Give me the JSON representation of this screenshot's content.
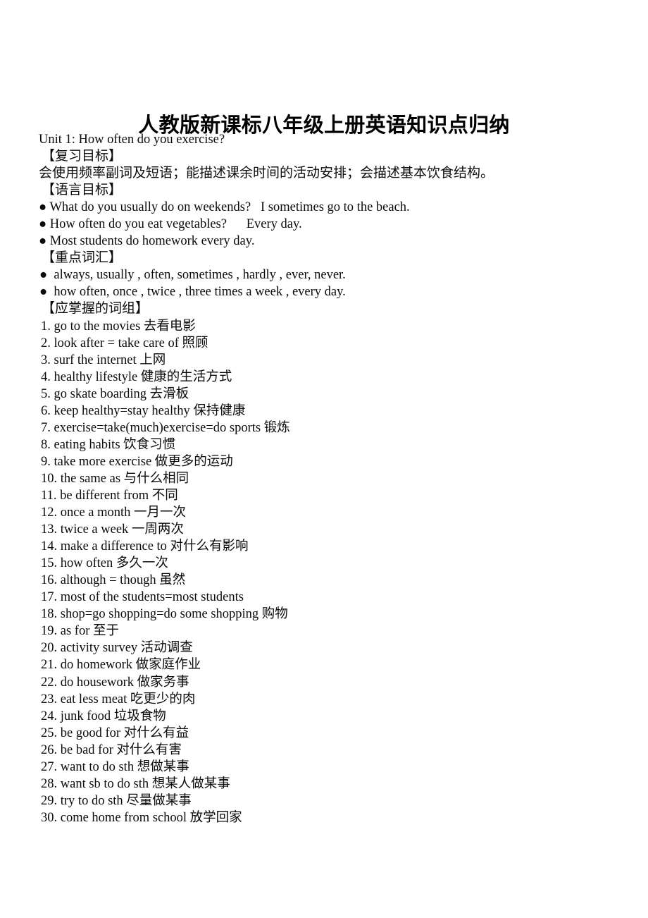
{
  "document": {
    "title": "人教版新课标八年级上册英语知识点归纳",
    "unit_heading": "Unit 1: How often do you exercise?",
    "sections": {
      "review_goal_heading": "【复习目标】",
      "review_goal_text": "会使用频率副词及短语；能描述课余时间的活动安排；会描述基本饮食结构。",
      "language_goal_heading": "【语言目标】",
      "language_goal_bullets": [
        "● What do you usually do on weekends?   I sometimes go to the beach.",
        "● How often do you eat vegetables?      Every day.",
        "● Most students do homework every day."
      ],
      "key_vocab_heading": "【重点词汇】",
      "key_vocab_bullets": [
        "●  always, usually , often, sometimes , hardly , ever, never.",
        "●  how often, once , twice , three times a week , every day."
      ],
      "phrases_heading": "【应掌握的词组】",
      "phrases": [
        "1. go to the movies 去看电影",
        "2. look after = take care of 照顾",
        "3. surf the internet 上网",
        "4. healthy lifestyle 健康的生活方式",
        "5. go skate boarding 去滑板",
        "6. keep healthy=stay healthy 保持健康",
        "7. exercise=take(much)exercise=do sports 锻炼",
        "8. eating habits 饮食习惯",
        "9. take more exercise 做更多的运动",
        "10. the same as 与什么相同",
        "11. be different from 不同",
        "12. once a month 一月一次",
        "13. twice a week 一周两次",
        "14. make a difference to 对什么有影响",
        "15. how often 多久一次",
        "16. although = though 虽然",
        "17. most of the students=most students",
        "18. shop=go shopping=do some shopping 购物",
        "19. as for 至于",
        "20. activity survey 活动调查",
        "21. do homework 做家庭作业",
        "22. do housework 做家务事",
        "23. eat less meat 吃更少的肉",
        "24. junk food 垃圾食物",
        "25. be good for 对什么有益",
        "26. be bad for 对什么有害",
        "27. want to do sth 想做某事",
        "28. want sb to do sth 想某人做某事",
        "29. try to do sth 尽量做某事",
        "30. come home from school 放学回家"
      ]
    }
  }
}
